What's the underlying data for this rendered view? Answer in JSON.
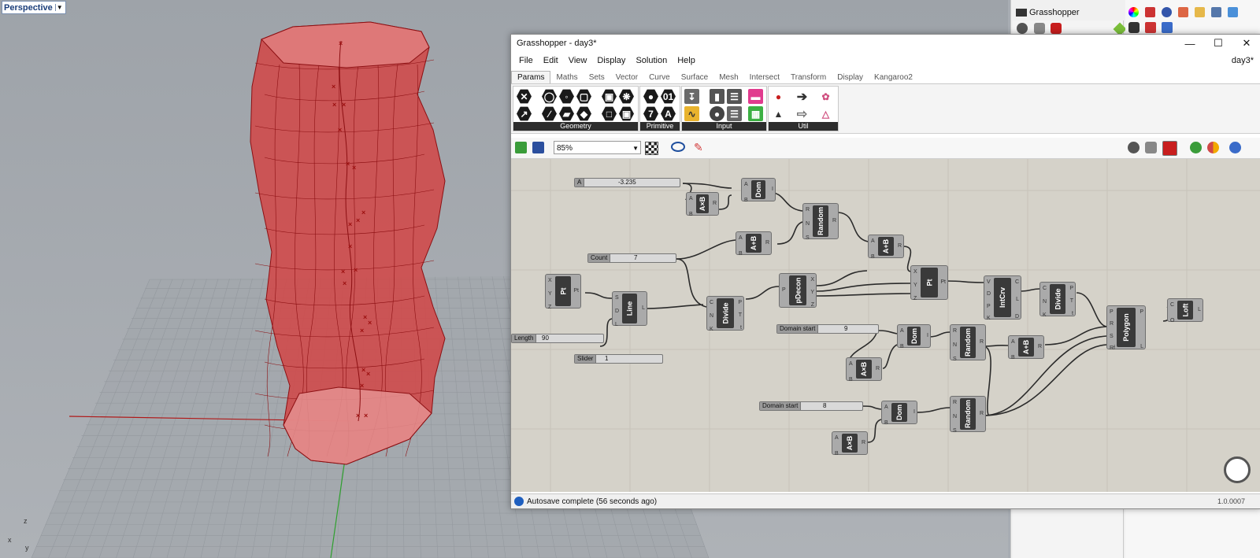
{
  "viewport": {
    "label": "Perspective",
    "axes": {
      "z": "z",
      "x": "x",
      "y": "y"
    }
  },
  "rhino_panel": {
    "title": "Grasshopper"
  },
  "gh": {
    "title": "Grasshopper - day3*",
    "doc_name": "day3*",
    "window_buttons": {
      "minimize": "—",
      "maximize": "☐",
      "close": "✕"
    },
    "menu": [
      "File",
      "Edit",
      "View",
      "Display",
      "Solution",
      "Help"
    ],
    "tabs": [
      "Params",
      "Maths",
      "Sets",
      "Vector",
      "Curve",
      "Surface",
      "Mesh",
      "Intersect",
      "Transform",
      "Display",
      "Kangaroo2"
    ],
    "active_tab": "Params",
    "ribbon_groups": [
      "Geometry",
      "Primitive",
      "Input",
      "Util"
    ],
    "zoom": "85%",
    "status": "Autosave complete (56 seconds ago)",
    "version": "1.0.0007"
  },
  "canvas": {
    "sliders": [
      {
        "name": "A",
        "value": "-3.235"
      },
      {
        "name": "Count",
        "value": "7"
      },
      {
        "name": "Length",
        "value": "90"
      },
      {
        "name": "Slider",
        "value": "1"
      },
      {
        "name": "Domain start",
        "value": "9"
      },
      {
        "name": "Domain start",
        "value": "8"
      }
    ],
    "components": [
      {
        "label": "Dom",
        "inputs": [
          "A",
          "B"
        ],
        "outputs": [
          "I"
        ]
      },
      {
        "label": "A×B",
        "inputs": [
          "A",
          "B"
        ],
        "outputs": [
          "R"
        ]
      },
      {
        "label": "Random",
        "inputs": [
          "R",
          "N",
          "S"
        ],
        "outputs": [
          "R"
        ]
      },
      {
        "label": "A+B",
        "inputs": [
          "A",
          "B"
        ],
        "outputs": [
          "R"
        ]
      },
      {
        "label": "A+B",
        "inputs": [
          "A",
          "B"
        ],
        "outputs": [
          "R"
        ]
      },
      {
        "label": "Pt",
        "inputs": [
          "X",
          "Y",
          "Z"
        ],
        "outputs": [
          "Pt"
        ]
      },
      {
        "label": "Line",
        "inputs": [
          "S",
          "D",
          "L"
        ],
        "outputs": [
          "L"
        ]
      },
      {
        "label": "Divide",
        "inputs": [
          "C",
          "N",
          "K"
        ],
        "outputs": [
          "P",
          "T",
          "t"
        ]
      },
      {
        "label": "pDecon",
        "inputs": [
          "P"
        ],
        "outputs": [
          "X",
          "Y",
          "Z"
        ]
      },
      {
        "label": "Pt",
        "inputs": [
          "X",
          "Y",
          "Z"
        ],
        "outputs": [
          "Pt"
        ]
      },
      {
        "label": "IntCrv",
        "inputs": [
          "V",
          "D",
          "P",
          "K"
        ],
        "outputs": [
          "C",
          "L",
          "D"
        ]
      },
      {
        "label": "Divide",
        "inputs": [
          "C",
          "N",
          "K"
        ],
        "outputs": [
          "P",
          "T",
          "t"
        ]
      },
      {
        "label": "Polygon",
        "inputs": [
          "P",
          "R",
          "S",
          "Rf"
        ],
        "outputs": [
          "P",
          "L"
        ]
      },
      {
        "label": "Loft",
        "inputs": [
          "C",
          "O"
        ],
        "outputs": [
          "L"
        ]
      },
      {
        "label": "Dom",
        "inputs": [
          "A",
          "B"
        ],
        "outputs": [
          "I"
        ]
      },
      {
        "label": "Random",
        "inputs": [
          "R",
          "N",
          "S"
        ],
        "outputs": [
          "R"
        ]
      },
      {
        "label": "A+B",
        "inputs": [
          "A",
          "B"
        ],
        "outputs": [
          "R"
        ]
      },
      {
        "label": "A×B",
        "inputs": [
          "A",
          "B"
        ],
        "outputs": [
          "R"
        ]
      },
      {
        "label": "Dom",
        "inputs": [
          "A",
          "B"
        ],
        "outputs": [
          "I"
        ]
      },
      {
        "label": "Random",
        "inputs": [
          "R",
          "N",
          "S"
        ],
        "outputs": [
          "R"
        ]
      },
      {
        "label": "A×B",
        "inputs": [
          "A",
          "B"
        ],
        "outputs": [
          "R"
        ]
      }
    ]
  },
  "colors": {
    "surface": "#d23a3a",
    "edge": "#8c0f12",
    "canvas": "#d5d2c9",
    "node": "#aaaaaa",
    "node_core": "#3a3a3a"
  }
}
